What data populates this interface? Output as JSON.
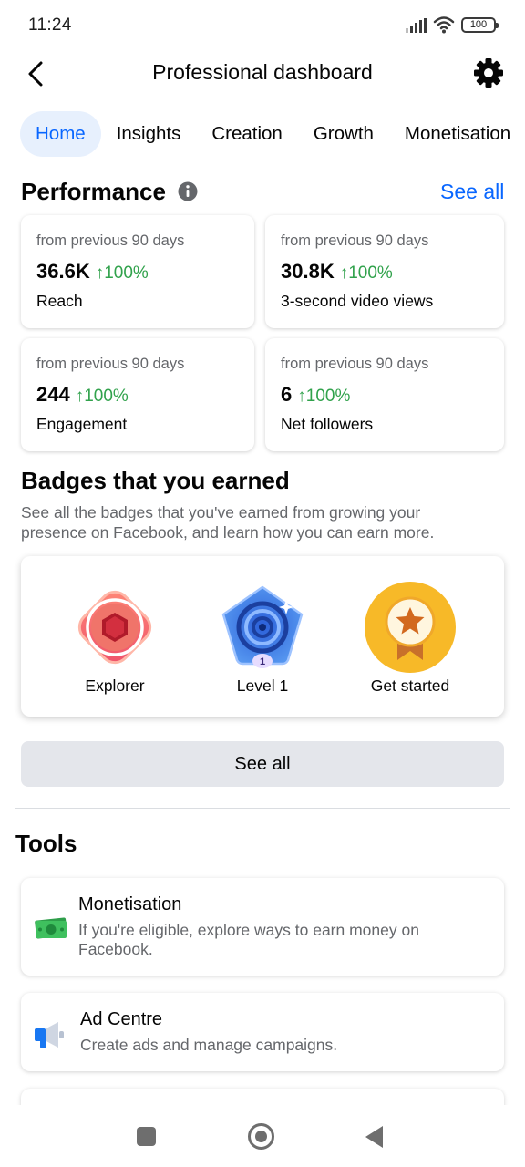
{
  "status_bar": {
    "time": "11:24",
    "battery": "100",
    "icons": [
      "signal-icon",
      "wifi-icon",
      "battery-icon"
    ]
  },
  "header": {
    "title": "Professional dashboard",
    "back_icon": "chevron-left-icon",
    "settings_icon": "gear-icon"
  },
  "tabs": [
    {
      "label": "Home",
      "active": true
    },
    {
      "label": "Insights"
    },
    {
      "label": "Creation"
    },
    {
      "label": "Growth"
    },
    {
      "label": "Monetisation"
    }
  ],
  "performance": {
    "title": "Performance",
    "see_all": "See all",
    "cards": [
      {
        "period": "from previous 90 days",
        "value": "36.6K",
        "change": "↑100%",
        "label": "Reach"
      },
      {
        "period": "from previous 90 days",
        "value": "30.8K",
        "change": "↑100%",
        "label": "3-second video views"
      },
      {
        "period": "from previous 90 days",
        "value": "244",
        "change": "↑100%",
        "label": "Engagement"
      },
      {
        "period": "from previous 90 days",
        "value": "6",
        "change": "↑100%",
        "label": "Net followers"
      }
    ]
  },
  "badges": {
    "title": "Badges that you earned",
    "description": "See all the badges that you've earned from growing your presence on Facebook, and learn how you can earn more.",
    "items": [
      {
        "label": "Explorer",
        "icon": "explorer-badge-icon"
      },
      {
        "label": "Level 1",
        "icon": "level-badge-icon",
        "badge_number": "1"
      },
      {
        "label": "Get started",
        "icon": "star-medal-icon"
      }
    ],
    "see_all_button": "See all"
  },
  "tools": {
    "title": "Tools",
    "items": [
      {
        "name": "Monetisation",
        "description": "If you're eligible, explore ways to earn money on Facebook.",
        "icon": "money-icon"
      },
      {
        "name": "Ad Centre",
        "description": "Create ads and manage campaigns.",
        "icon": "megaphone-icon"
      }
    ]
  },
  "colors": {
    "accent": "#0866ff",
    "positive": "#31a24c",
    "secondary_text": "#65676b"
  },
  "nav_bar": {
    "icons": [
      "recents-icon",
      "home-circle-icon",
      "back-triangle-icon"
    ]
  }
}
